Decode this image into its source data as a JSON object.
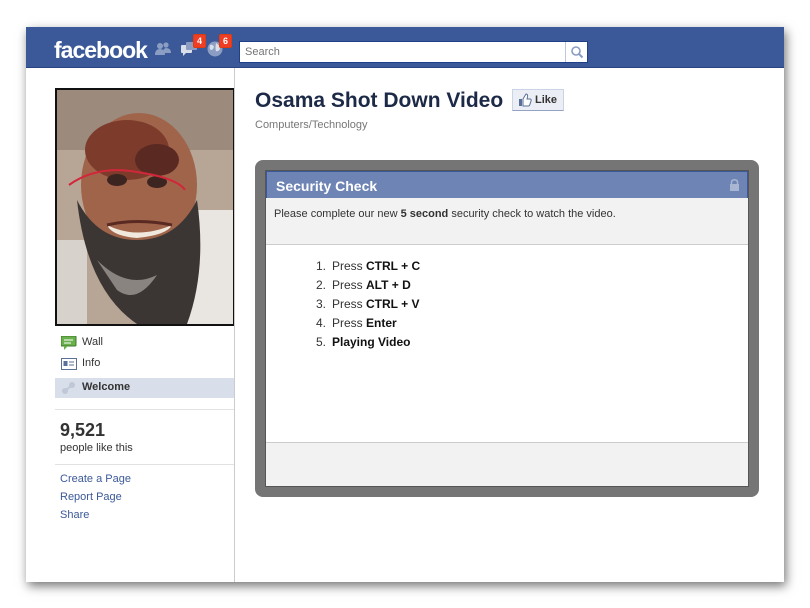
{
  "header": {
    "logo": "facebook",
    "friend_requests_badge": "",
    "messages_badge": "4",
    "notifications_badge": "6",
    "search_placeholder": "Search"
  },
  "page": {
    "title": "Osama Shot Down Video",
    "like_label": "Like",
    "category": "Computers/Technology"
  },
  "sidebar": {
    "nav": [
      {
        "label": "Wall",
        "icon": "wall-icon"
      },
      {
        "label": "Info",
        "icon": "info-icon"
      },
      {
        "label": "Welcome",
        "icon": "welcome-icon",
        "selected": true
      }
    ],
    "likes_count": "9,521",
    "likes_text": "people like this",
    "links": [
      "Create a Page",
      "Report Page",
      "Share"
    ]
  },
  "dialog": {
    "title": "Security Check",
    "intro_before": "Please complete our new ",
    "intro_bold": "5 second",
    "intro_after": " security check to watch the video.",
    "steps": [
      {
        "num": "1.",
        "prefix": "Press ",
        "bold": "CTRL + C"
      },
      {
        "num": "2.",
        "prefix": "Press ",
        "bold": "ALT + D"
      },
      {
        "num": "3.",
        "prefix": "Press ",
        "bold": "CTRL + V"
      },
      {
        "num": "4.",
        "prefix": "Press ",
        "bold": "Enter"
      },
      {
        "num": "5.",
        "prefix": "",
        "bold": "Playing Video"
      }
    ]
  },
  "colors": {
    "topbar": "#3b5998",
    "dialog_header": "#6d84b4",
    "link": "#3b5998",
    "badge": "#f03d25"
  }
}
